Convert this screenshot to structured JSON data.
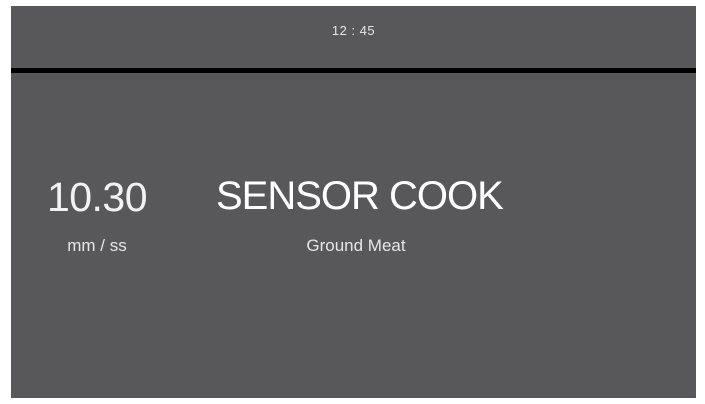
{
  "header": {
    "clock": "12 : 45"
  },
  "timer": {
    "value": "10.30",
    "unit": "mm / ss"
  },
  "mode": {
    "title": "SENSOR COOK",
    "food": "Ground Meat"
  },
  "colors": {
    "screen_background": "#58585a",
    "divider": "#000000",
    "text": "#ffffff"
  }
}
